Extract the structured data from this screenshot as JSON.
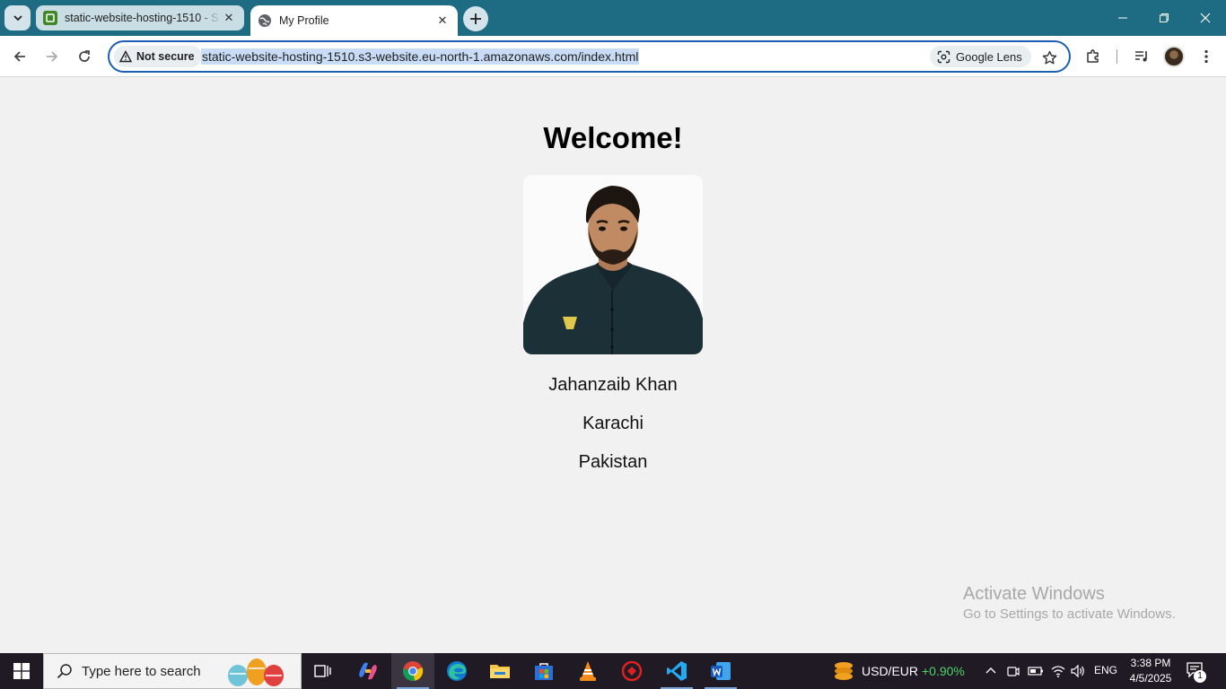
{
  "browser": {
    "tabs": [
      {
        "title": "static-website-hosting-1510 - S",
        "active": false
      },
      {
        "title": "My Profile",
        "active": true
      }
    ],
    "address_bar": {
      "security_label": "Not secure",
      "url": "static-website-hosting-1510.s3-website.eu-north-1.amazonaws.com/index.html",
      "lens_label": "Google Lens"
    }
  },
  "page": {
    "heading": "Welcome!",
    "photo_icon": "profile-photo",
    "name": "Jahanzaib Khan",
    "city": "Karachi",
    "country": "Pakistan"
  },
  "watermark": {
    "title": "Activate Windows",
    "subtitle": "Go to Settings to activate Windows."
  },
  "taskbar": {
    "search_placeholder": "Type here to search",
    "currency_label": "USD/EUR",
    "currency_change": "+0.90%",
    "language": "ENG",
    "time": "3:38 PM",
    "date": "4/5/2025",
    "notification_count": "1"
  },
  "colors": {
    "tabstrip": "#1e6b84",
    "omnibox_border": "#1a5fb4",
    "page_bg": "#f1f1f1",
    "taskbar": "#1f1a24",
    "currency_up": "#4cd36b"
  }
}
